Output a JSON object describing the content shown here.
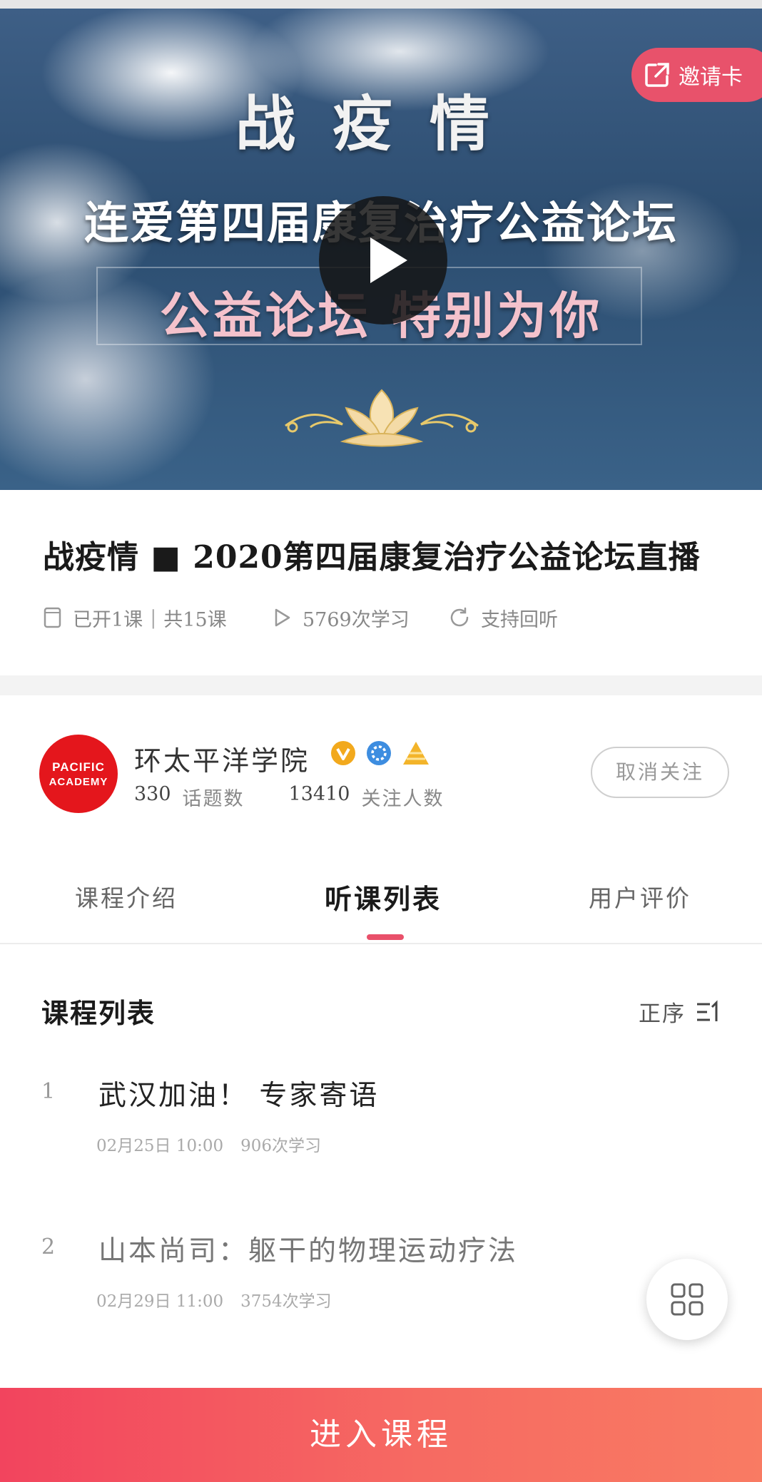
{
  "hero": {
    "line1": "战疫情",
    "line2": "连爱第四届康复治疗公益论坛",
    "line3": "公益论坛 特别为你",
    "invite_label": "邀请卡"
  },
  "course": {
    "title": "战疫情 ■ 2020第四届康复治疗公益论坛直播",
    "opened": "已开1课",
    "total": "共15课",
    "learn_count": "5769次学习",
    "replay": "支持回听"
  },
  "publisher": {
    "avatar_text_1": "PACIFIC",
    "avatar_text_2": "ACADEMY",
    "name": "环太平洋学院",
    "topics_count": "330",
    "topics_label": "话题数",
    "followers_count": "13410",
    "followers_label": "关注人数",
    "follow_button": "取消关注"
  },
  "tabs": [
    {
      "label": "课程介绍",
      "active": false
    },
    {
      "label": "听课列表",
      "active": true
    },
    {
      "label": "用户评价",
      "active": false
    }
  ],
  "list": {
    "title": "课程列表",
    "sort_label": "正序",
    "items": [
      {
        "index": "1",
        "title": "武汉加油！ 专家寄语",
        "date": "02月25日 10:00",
        "count": "906次学习",
        "title_color": "#222222"
      },
      {
        "index": "2",
        "title": "山本尚司：躯干的物理运动疗法",
        "date": "02月29日 11:00",
        "count": "3754次学习",
        "title_color": "#777777"
      }
    ]
  },
  "enter_button": "进入课程",
  "colors": {
    "accent": "#e9506a",
    "avatar": "#e4161c",
    "enter_gradient_start": "#f2445e",
    "enter_gradient_end": "#f97b63"
  },
  "icons": [
    "share-icon",
    "play-icon",
    "book-icon",
    "play-outline-icon",
    "refresh-icon",
    "verified-icon",
    "level-icon",
    "pyramid-icon",
    "sort-icon",
    "grid-icon"
  ]
}
